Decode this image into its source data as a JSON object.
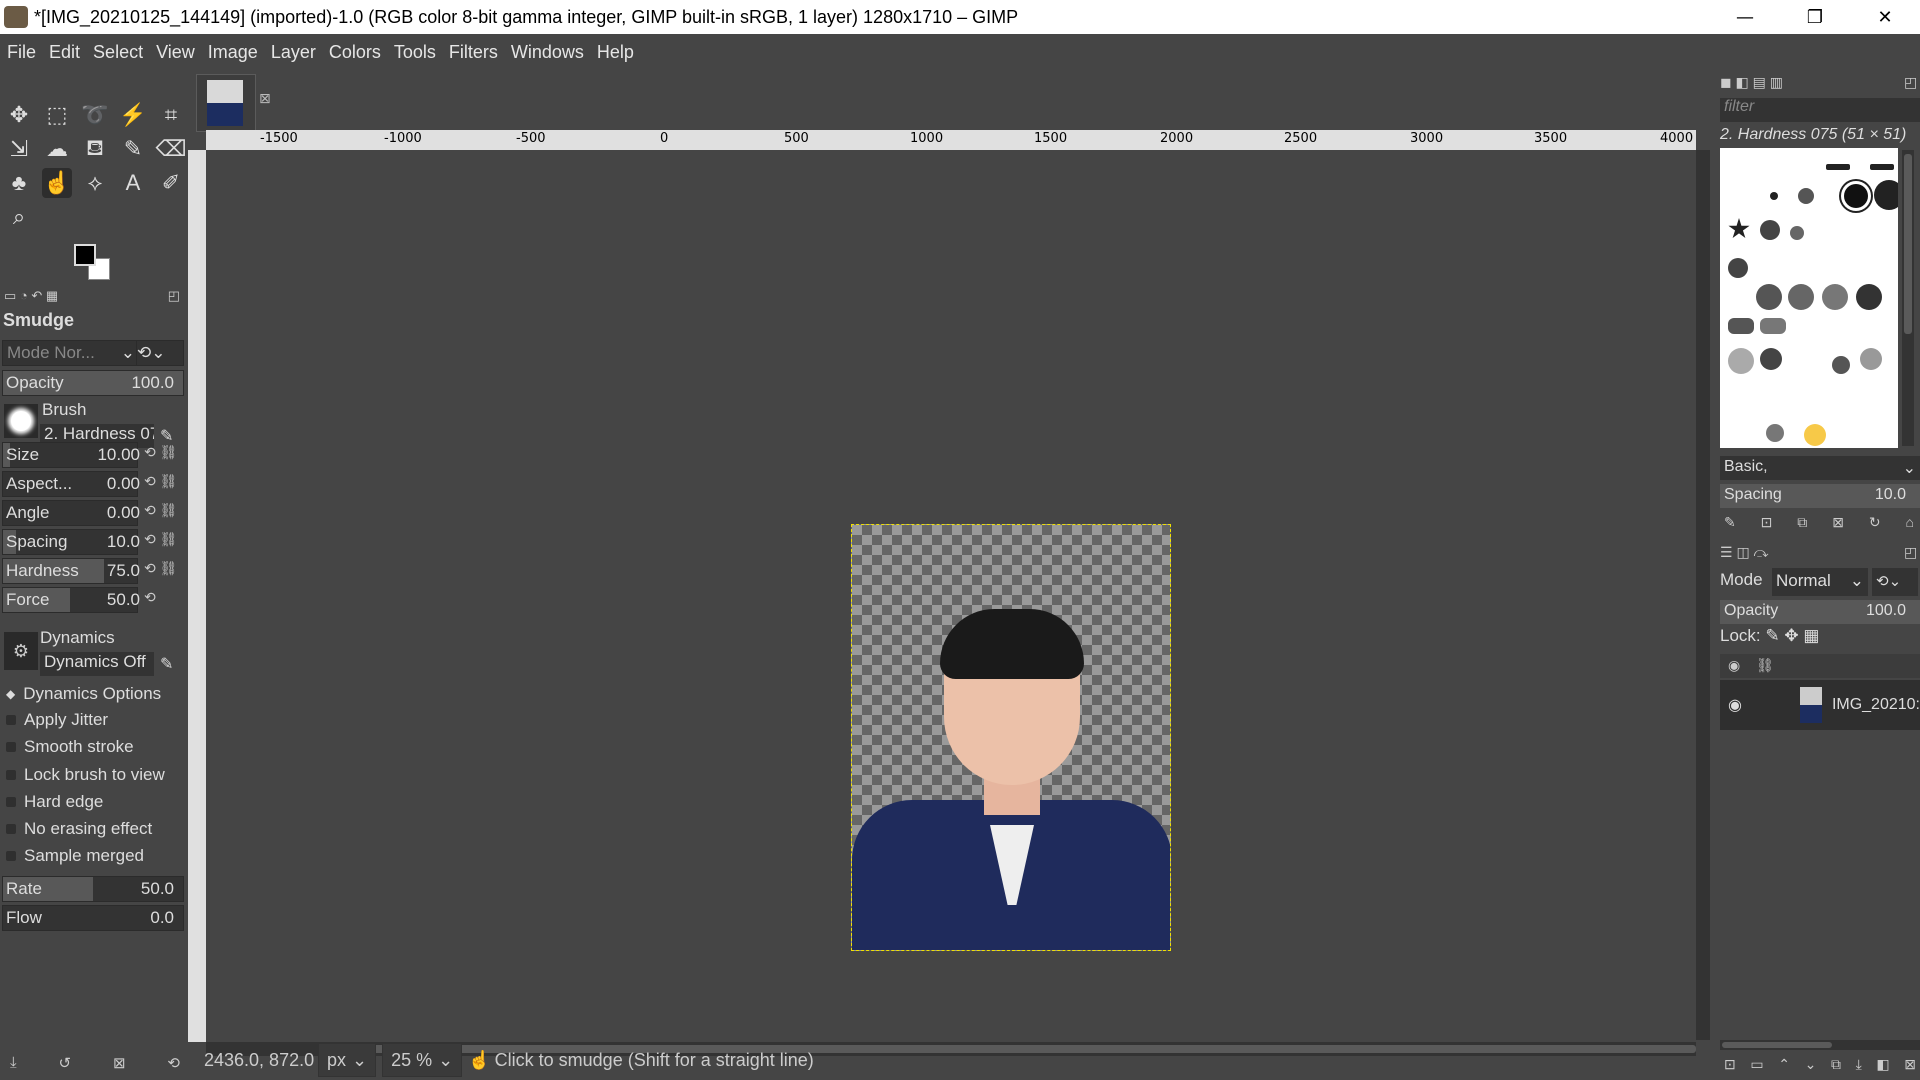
{
  "window": {
    "title": "*[IMG_20210125_144149] (imported)-1.0 (RGB color 8-bit gamma integer, GIMP built-in sRGB, 1 layer) 1280x1710 – GIMP",
    "minimize": "—",
    "maximize": "❐",
    "close": "✕"
  },
  "menu": [
    "File",
    "Edit",
    "Select",
    "View",
    "Image",
    "Layer",
    "Colors",
    "Tools",
    "Filters",
    "Windows",
    "Help"
  ],
  "tool_options": {
    "title": "Smudge",
    "mode": "Mode Nor...",
    "opacity": {
      "label": "Opacity",
      "value": "100.0",
      "fraction": 1.0
    },
    "brush_label": "Brush",
    "brush_name": "2. Hardness 07",
    "size": {
      "label": "Size",
      "value": "10.00",
      "fraction": 0.05
    },
    "aspect": {
      "label": "Aspect...",
      "value": "0.00",
      "fraction": 0.5
    },
    "angle": {
      "label": "Angle",
      "value": "0.00",
      "fraction": 0.5
    },
    "spacing": {
      "label": "Spacing",
      "value": "10.0",
      "fraction": 0.1
    },
    "hardness": {
      "label": "Hardness",
      "value": "75.0",
      "fraction": 0.75
    },
    "force": {
      "label": "Force",
      "value": "50.0",
      "fraction": 0.5
    },
    "dynamics_label": "Dynamics",
    "dynamics_value": "Dynamics Off",
    "dynamics_options": "Dynamics Options",
    "checks": [
      "Apply Jitter",
      "Smooth stroke",
      "Lock brush to view",
      "Hard edge",
      "No erasing effect",
      "Sample merged"
    ],
    "rate": {
      "label": "Rate",
      "value": "50.0",
      "fraction": 0.5
    },
    "flow": {
      "label": "Flow",
      "value": "0.0",
      "fraction": 0.0
    }
  },
  "ruler": {
    "ticks": [
      "-1500",
      "-1000",
      "-500",
      "0",
      "500",
      "1000",
      "1500",
      "2000",
      "2500",
      "3000",
      "3500",
      "4000"
    ]
  },
  "status": {
    "coords": "2436.0, 872.0",
    "unit": "px",
    "zoom": "25 %",
    "message": "Click to smudge (Shift for a straight line)"
  },
  "brushes": {
    "filter_placeholder": "filter",
    "selected": "2. Hardness 075 (51 × 51)",
    "tag": "Basic,",
    "spacing_label": "Spacing",
    "spacing_value": "10.0"
  },
  "layers": {
    "mode_label": "Mode",
    "mode_value": "Normal",
    "opacity_label": "Opacity",
    "opacity_value": "100.0",
    "lock_label": "Lock:",
    "layer_name": "IMG_20210:"
  }
}
